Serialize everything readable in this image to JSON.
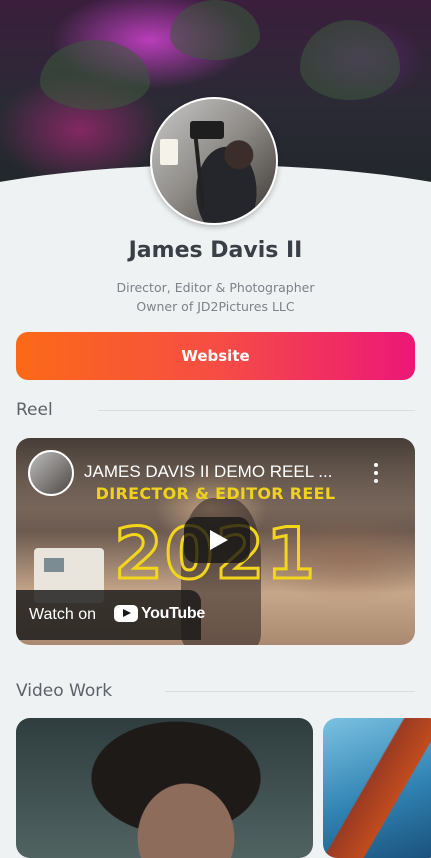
{
  "profile": {
    "name": "James Davis II",
    "subtitle_line1": "Director, Editor & Photographer",
    "subtitle_line2": "Owner of JD2Pictures LLC"
  },
  "links": {
    "website_label": "Website"
  },
  "sections": {
    "reel_title": "Reel",
    "video_work_title": "Video Work"
  },
  "reel_video": {
    "title": "JAMES DAVIS II DEMO REEL ...",
    "overlay_line1": "DIRECTOR & EDITOR REEL",
    "overlay_line2": "2021",
    "watch_on_label": "Watch on",
    "youtube_wordmark": "YouTube"
  },
  "colors": {
    "button_gradient_start": "#fb6a17",
    "button_gradient_end": "#ec1778",
    "page_background": "#eef2f2",
    "overlay_yellow": "#f3d61b"
  },
  "icons": [
    "play-icon",
    "youtube-logo-icon",
    "more-options-icon"
  ]
}
